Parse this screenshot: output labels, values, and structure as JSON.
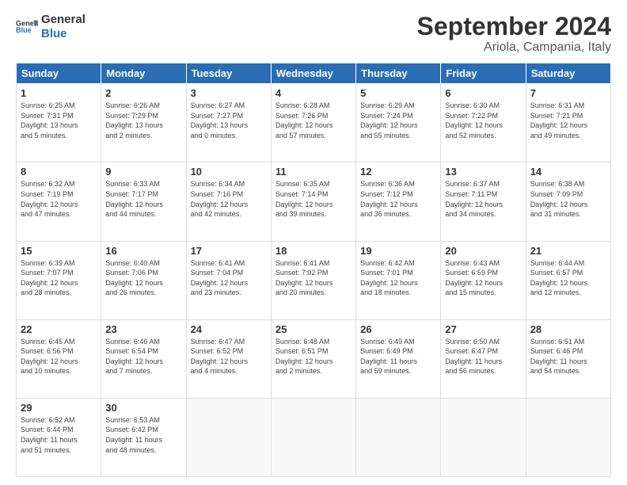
{
  "logo": {
    "line1": "General",
    "line2": "Blue"
  },
  "title": "September 2024",
  "subtitle": "Ariola, Campania, Italy",
  "header_days": [
    "Sunday",
    "Monday",
    "Tuesday",
    "Wednesday",
    "Thursday",
    "Friday",
    "Saturday"
  ],
  "weeks": [
    [
      {
        "day": "1",
        "info": "Sunrise: 6:25 AM\nSunset: 7:31 PM\nDaylight: 13 hours\nand 5 minutes."
      },
      {
        "day": "2",
        "info": "Sunrise: 6:26 AM\nSunset: 7:29 PM\nDaylight: 13 hours\nand 2 minutes."
      },
      {
        "day": "3",
        "info": "Sunrise: 6:27 AM\nSunset: 7:27 PM\nDaylight: 13 hours\nand 0 minutes."
      },
      {
        "day": "4",
        "info": "Sunrise: 6:28 AM\nSunset: 7:26 PM\nDaylight: 12 hours\nand 57 minutes."
      },
      {
        "day": "5",
        "info": "Sunrise: 6:29 AM\nSunset: 7:24 PM\nDaylight: 12 hours\nand 55 minutes."
      },
      {
        "day": "6",
        "info": "Sunrise: 6:30 AM\nSunset: 7:22 PM\nDaylight: 12 hours\nand 52 minutes."
      },
      {
        "day": "7",
        "info": "Sunrise: 6:31 AM\nSunset: 7:21 PM\nDaylight: 12 hours\nand 49 minutes."
      }
    ],
    [
      {
        "day": "8",
        "info": "Sunrise: 6:32 AM\nSunset: 7:19 PM\nDaylight: 12 hours\nand 47 minutes."
      },
      {
        "day": "9",
        "info": "Sunrise: 6:33 AM\nSunset: 7:17 PM\nDaylight: 12 hours\nand 44 minutes."
      },
      {
        "day": "10",
        "info": "Sunrise: 6:34 AM\nSunset: 7:16 PM\nDaylight: 12 hours\nand 42 minutes."
      },
      {
        "day": "11",
        "info": "Sunrise: 6:35 AM\nSunset: 7:14 PM\nDaylight: 12 hours\nand 39 minutes."
      },
      {
        "day": "12",
        "info": "Sunrise: 6:36 AM\nSunset: 7:12 PM\nDaylight: 12 hours\nand 36 minutes."
      },
      {
        "day": "13",
        "info": "Sunrise: 6:37 AM\nSunset: 7:11 PM\nDaylight: 12 hours\nand 34 minutes."
      },
      {
        "day": "14",
        "info": "Sunrise: 6:38 AM\nSunset: 7:09 PM\nDaylight: 12 hours\nand 31 minutes."
      }
    ],
    [
      {
        "day": "15",
        "info": "Sunrise: 6:39 AM\nSunset: 7:07 PM\nDaylight: 12 hours\nand 28 minutes."
      },
      {
        "day": "16",
        "info": "Sunrise: 6:40 AM\nSunset: 7:06 PM\nDaylight: 12 hours\nand 26 minutes."
      },
      {
        "day": "17",
        "info": "Sunrise: 6:41 AM\nSunset: 7:04 PM\nDaylight: 12 hours\nand 23 minutes."
      },
      {
        "day": "18",
        "info": "Sunrise: 6:41 AM\nSunset: 7:02 PM\nDaylight: 12 hours\nand 20 minutes."
      },
      {
        "day": "19",
        "info": "Sunrise: 6:42 AM\nSunset: 7:01 PM\nDaylight: 12 hours\nand 18 minutes."
      },
      {
        "day": "20",
        "info": "Sunrise: 6:43 AM\nSunset: 6:59 PM\nDaylight: 12 hours\nand 15 minutes."
      },
      {
        "day": "21",
        "info": "Sunrise: 6:44 AM\nSunset: 6:57 PM\nDaylight: 12 hours\nand 12 minutes."
      }
    ],
    [
      {
        "day": "22",
        "info": "Sunrise: 6:45 AM\nSunset: 6:56 PM\nDaylight: 12 hours\nand 10 minutes."
      },
      {
        "day": "23",
        "info": "Sunrise: 6:46 AM\nSunset: 6:54 PM\nDaylight: 12 hours\nand 7 minutes."
      },
      {
        "day": "24",
        "info": "Sunrise: 6:47 AM\nSunset: 6:52 PM\nDaylight: 12 hours\nand 4 minutes."
      },
      {
        "day": "25",
        "info": "Sunrise: 6:48 AM\nSunset: 6:51 PM\nDaylight: 12 hours\nand 2 minutes."
      },
      {
        "day": "26",
        "info": "Sunrise: 6:49 AM\nSunset: 6:49 PM\nDaylight: 11 hours\nand 59 minutes."
      },
      {
        "day": "27",
        "info": "Sunrise: 6:50 AM\nSunset: 6:47 PM\nDaylight: 11 hours\nand 56 minutes."
      },
      {
        "day": "28",
        "info": "Sunrise: 6:51 AM\nSunset: 6:46 PM\nDaylight: 11 hours\nand 54 minutes."
      }
    ],
    [
      {
        "day": "29",
        "info": "Sunrise: 6:52 AM\nSunset: 6:44 PM\nDaylight: 11 hours\nand 51 minutes."
      },
      {
        "day": "30",
        "info": "Sunrise: 6:53 AM\nSunset: 6:42 PM\nDaylight: 11 hours\nand 48 minutes."
      },
      {
        "day": "",
        "info": ""
      },
      {
        "day": "",
        "info": ""
      },
      {
        "day": "",
        "info": ""
      },
      {
        "day": "",
        "info": ""
      },
      {
        "day": "",
        "info": ""
      }
    ]
  ]
}
